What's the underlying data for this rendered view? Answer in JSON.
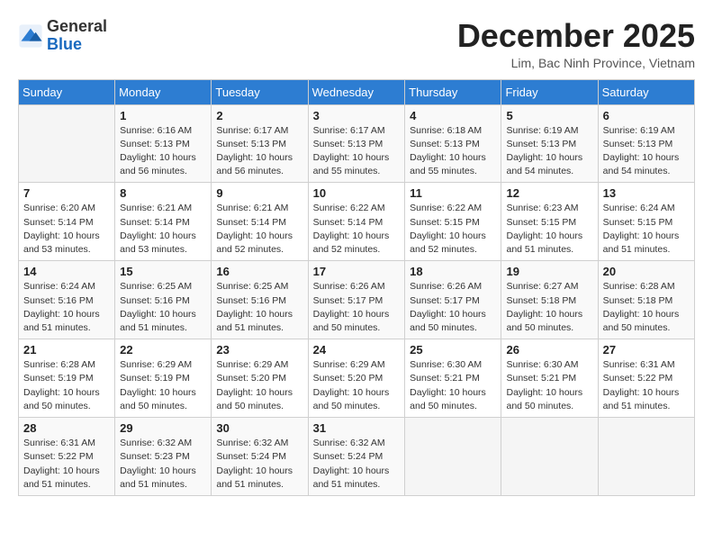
{
  "header": {
    "logo_general": "General",
    "logo_blue": "Blue",
    "month_title": "December 2025",
    "location": "Lim, Bac Ninh Province, Vietnam"
  },
  "days_of_week": [
    "Sunday",
    "Monday",
    "Tuesday",
    "Wednesday",
    "Thursday",
    "Friday",
    "Saturday"
  ],
  "weeks": [
    [
      {
        "day": "",
        "info": ""
      },
      {
        "day": "1",
        "info": "Sunrise: 6:16 AM\nSunset: 5:13 PM\nDaylight: 10 hours\nand 56 minutes."
      },
      {
        "day": "2",
        "info": "Sunrise: 6:17 AM\nSunset: 5:13 PM\nDaylight: 10 hours\nand 56 minutes."
      },
      {
        "day": "3",
        "info": "Sunrise: 6:17 AM\nSunset: 5:13 PM\nDaylight: 10 hours\nand 55 minutes."
      },
      {
        "day": "4",
        "info": "Sunrise: 6:18 AM\nSunset: 5:13 PM\nDaylight: 10 hours\nand 55 minutes."
      },
      {
        "day": "5",
        "info": "Sunrise: 6:19 AM\nSunset: 5:13 PM\nDaylight: 10 hours\nand 54 minutes."
      },
      {
        "day": "6",
        "info": "Sunrise: 6:19 AM\nSunset: 5:13 PM\nDaylight: 10 hours\nand 54 minutes."
      }
    ],
    [
      {
        "day": "7",
        "info": "Sunrise: 6:20 AM\nSunset: 5:14 PM\nDaylight: 10 hours\nand 53 minutes."
      },
      {
        "day": "8",
        "info": "Sunrise: 6:21 AM\nSunset: 5:14 PM\nDaylight: 10 hours\nand 53 minutes."
      },
      {
        "day": "9",
        "info": "Sunrise: 6:21 AM\nSunset: 5:14 PM\nDaylight: 10 hours\nand 52 minutes."
      },
      {
        "day": "10",
        "info": "Sunrise: 6:22 AM\nSunset: 5:14 PM\nDaylight: 10 hours\nand 52 minutes."
      },
      {
        "day": "11",
        "info": "Sunrise: 6:22 AM\nSunset: 5:15 PM\nDaylight: 10 hours\nand 52 minutes."
      },
      {
        "day": "12",
        "info": "Sunrise: 6:23 AM\nSunset: 5:15 PM\nDaylight: 10 hours\nand 51 minutes."
      },
      {
        "day": "13",
        "info": "Sunrise: 6:24 AM\nSunset: 5:15 PM\nDaylight: 10 hours\nand 51 minutes."
      }
    ],
    [
      {
        "day": "14",
        "info": "Sunrise: 6:24 AM\nSunset: 5:16 PM\nDaylight: 10 hours\nand 51 minutes."
      },
      {
        "day": "15",
        "info": "Sunrise: 6:25 AM\nSunset: 5:16 PM\nDaylight: 10 hours\nand 51 minutes."
      },
      {
        "day": "16",
        "info": "Sunrise: 6:25 AM\nSunset: 5:16 PM\nDaylight: 10 hours\nand 51 minutes."
      },
      {
        "day": "17",
        "info": "Sunrise: 6:26 AM\nSunset: 5:17 PM\nDaylight: 10 hours\nand 50 minutes."
      },
      {
        "day": "18",
        "info": "Sunrise: 6:26 AM\nSunset: 5:17 PM\nDaylight: 10 hours\nand 50 minutes."
      },
      {
        "day": "19",
        "info": "Sunrise: 6:27 AM\nSunset: 5:18 PM\nDaylight: 10 hours\nand 50 minutes."
      },
      {
        "day": "20",
        "info": "Sunrise: 6:28 AM\nSunset: 5:18 PM\nDaylight: 10 hours\nand 50 minutes."
      }
    ],
    [
      {
        "day": "21",
        "info": "Sunrise: 6:28 AM\nSunset: 5:19 PM\nDaylight: 10 hours\nand 50 minutes."
      },
      {
        "day": "22",
        "info": "Sunrise: 6:29 AM\nSunset: 5:19 PM\nDaylight: 10 hours\nand 50 minutes."
      },
      {
        "day": "23",
        "info": "Sunrise: 6:29 AM\nSunset: 5:20 PM\nDaylight: 10 hours\nand 50 minutes."
      },
      {
        "day": "24",
        "info": "Sunrise: 6:29 AM\nSunset: 5:20 PM\nDaylight: 10 hours\nand 50 minutes."
      },
      {
        "day": "25",
        "info": "Sunrise: 6:30 AM\nSunset: 5:21 PM\nDaylight: 10 hours\nand 50 minutes."
      },
      {
        "day": "26",
        "info": "Sunrise: 6:30 AM\nSunset: 5:21 PM\nDaylight: 10 hours\nand 50 minutes."
      },
      {
        "day": "27",
        "info": "Sunrise: 6:31 AM\nSunset: 5:22 PM\nDaylight: 10 hours\nand 51 minutes."
      }
    ],
    [
      {
        "day": "28",
        "info": "Sunrise: 6:31 AM\nSunset: 5:22 PM\nDaylight: 10 hours\nand 51 minutes."
      },
      {
        "day": "29",
        "info": "Sunrise: 6:32 AM\nSunset: 5:23 PM\nDaylight: 10 hours\nand 51 minutes."
      },
      {
        "day": "30",
        "info": "Sunrise: 6:32 AM\nSunset: 5:24 PM\nDaylight: 10 hours\nand 51 minutes."
      },
      {
        "day": "31",
        "info": "Sunrise: 6:32 AM\nSunset: 5:24 PM\nDaylight: 10 hours\nand 51 minutes."
      },
      {
        "day": "",
        "info": ""
      },
      {
        "day": "",
        "info": ""
      },
      {
        "day": "",
        "info": ""
      }
    ]
  ]
}
